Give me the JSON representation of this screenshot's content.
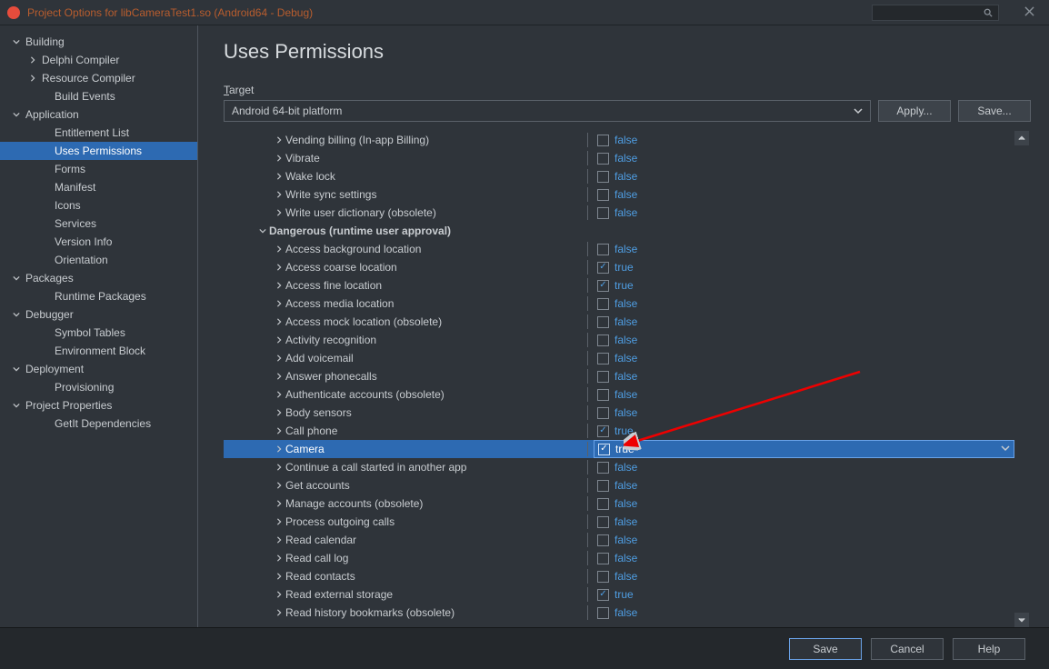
{
  "title": "Project Options for libCameraTest1.so  (Android64 - Debug)",
  "sidebar": [
    {
      "label": "Building",
      "level": 0,
      "chev": "down"
    },
    {
      "label": "Delphi Compiler",
      "level": 1,
      "chev": "right"
    },
    {
      "label": "Resource Compiler",
      "level": 1,
      "chev": "right"
    },
    {
      "label": "Build Events",
      "level": 2,
      "chev": ""
    },
    {
      "label": "Application",
      "level": 0,
      "chev": "down"
    },
    {
      "label": "Entitlement List",
      "level": 2,
      "chev": ""
    },
    {
      "label": "Uses Permissions",
      "level": 2,
      "chev": "",
      "selected": true
    },
    {
      "label": "Forms",
      "level": 2,
      "chev": ""
    },
    {
      "label": "Manifest",
      "level": 2,
      "chev": ""
    },
    {
      "label": "Icons",
      "level": 2,
      "chev": ""
    },
    {
      "label": "Services",
      "level": 2,
      "chev": ""
    },
    {
      "label": "Version Info",
      "level": 2,
      "chev": ""
    },
    {
      "label": "Orientation",
      "level": 2,
      "chev": ""
    },
    {
      "label": "Packages",
      "level": 0,
      "chev": "down"
    },
    {
      "label": "Runtime Packages",
      "level": 2,
      "chev": ""
    },
    {
      "label": "Debugger",
      "level": 0,
      "chev": "down"
    },
    {
      "label": "Symbol Tables",
      "level": 2,
      "chev": ""
    },
    {
      "label": "Environment Block",
      "level": 2,
      "chev": ""
    },
    {
      "label": "Deployment",
      "level": 0,
      "chev": "down"
    },
    {
      "label": "Provisioning",
      "level": 2,
      "chev": ""
    },
    {
      "label": "Project Properties",
      "level": 0,
      "chev": "down"
    },
    {
      "label": "GetIt Dependencies",
      "level": 2,
      "chev": ""
    }
  ],
  "heading": "Uses Permissions",
  "target_label": "Target",
  "target_value": "Android 64-bit platform",
  "buttons": {
    "apply": "Apply...",
    "saveTop": "Save...",
    "save": "Save",
    "cancel": "Cancel",
    "help": "Help"
  },
  "permissions": [
    {
      "label": "Vending billing (In-app Billing)",
      "indent": 1,
      "chev": "right",
      "value": "false",
      "checked": false
    },
    {
      "label": "Vibrate",
      "indent": 1,
      "chev": "right",
      "value": "false",
      "checked": false
    },
    {
      "label": "Wake lock",
      "indent": 1,
      "chev": "right",
      "value": "false",
      "checked": false
    },
    {
      "label": "Write sync settings",
      "indent": 1,
      "chev": "right",
      "value": "false",
      "checked": false
    },
    {
      "label": "Write user dictionary (obsolete)",
      "indent": 1,
      "chev": "right",
      "value": "false",
      "checked": false
    },
    {
      "label": "Dangerous (runtime user approval)",
      "indent": 0,
      "chev": "down",
      "header": true
    },
    {
      "label": "Access background location",
      "indent": 1,
      "chev": "right",
      "value": "false",
      "checked": false
    },
    {
      "label": "Access coarse location",
      "indent": 1,
      "chev": "right",
      "value": "true",
      "checked": true
    },
    {
      "label": "Access fine location",
      "indent": 1,
      "chev": "right",
      "value": "true",
      "checked": true
    },
    {
      "label": "Access media location",
      "indent": 1,
      "chev": "right",
      "value": "false",
      "checked": false
    },
    {
      "label": "Access mock location (obsolete)",
      "indent": 1,
      "chev": "right",
      "value": "false",
      "checked": false
    },
    {
      "label": "Activity recognition",
      "indent": 1,
      "chev": "right",
      "value": "false",
      "checked": false
    },
    {
      "label": "Add voicemail",
      "indent": 1,
      "chev": "right",
      "value": "false",
      "checked": false
    },
    {
      "label": "Answer phonecalls",
      "indent": 1,
      "chev": "right",
      "value": "false",
      "checked": false
    },
    {
      "label": "Authenticate accounts (obsolete)",
      "indent": 1,
      "chev": "right",
      "value": "false",
      "checked": false
    },
    {
      "label": "Body sensors",
      "indent": 1,
      "chev": "right",
      "value": "false",
      "checked": false
    },
    {
      "label": "Call phone",
      "indent": 1,
      "chev": "right",
      "value": "true",
      "checked": true
    },
    {
      "label": "Camera",
      "indent": 1,
      "chev": "right",
      "value": "true",
      "checked": true,
      "selected": true
    },
    {
      "label": "Continue a call started in another app",
      "indent": 1,
      "chev": "right",
      "value": "false",
      "checked": false
    },
    {
      "label": "Get accounts",
      "indent": 1,
      "chev": "right",
      "value": "false",
      "checked": false
    },
    {
      "label": "Manage accounts (obsolete)",
      "indent": 1,
      "chev": "right",
      "value": "false",
      "checked": false
    },
    {
      "label": "Process outgoing calls",
      "indent": 1,
      "chev": "right",
      "value": "false",
      "checked": false
    },
    {
      "label": "Read calendar",
      "indent": 1,
      "chev": "right",
      "value": "false",
      "checked": false
    },
    {
      "label": "Read call log",
      "indent": 1,
      "chev": "right",
      "value": "false",
      "checked": false
    },
    {
      "label": "Read contacts",
      "indent": 1,
      "chev": "right",
      "value": "false",
      "checked": false
    },
    {
      "label": "Read external storage",
      "indent": 1,
      "chev": "right",
      "value": "true",
      "checked": true
    },
    {
      "label": "Read history bookmarks (obsolete)",
      "indent": 1,
      "chev": "right",
      "value": "false",
      "checked": false
    }
  ]
}
